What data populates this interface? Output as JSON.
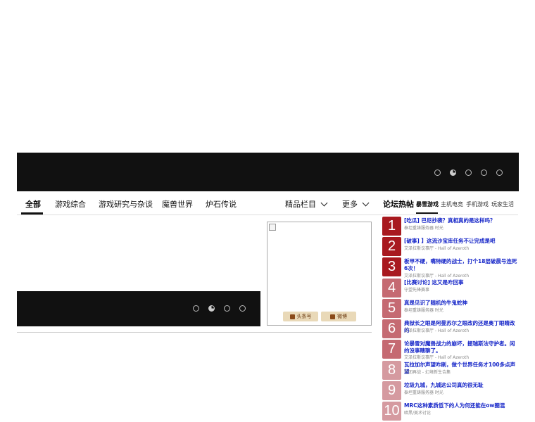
{
  "nav": {
    "tabs": [
      "全部",
      "游戏综合",
      "游戏研究与杂谈",
      "魔兽世界",
      "炉石传说"
    ],
    "featured": "精品栏目",
    "more": "更多"
  },
  "promo": {
    "tag1": "头条号",
    "tag2": "微博"
  },
  "forum": {
    "title": "论坛热帖",
    "tabs": [
      "暴雪游戏",
      "主机电竞",
      "手机游戏",
      "玩家生活"
    ],
    "posts": [
      {
        "rank": "1",
        "title": "[吃瓜] 巴尼抄袭？真相真的是这样吗？",
        "source": "泰坦重铸服务器 时光"
      },
      {
        "rank": "2",
        "title": "[破事] 】这流沙宝库任务不让完成是吧",
        "source": "艾泽拉斯议事厅 - Hall of Azeroth"
      },
      {
        "rank": "3",
        "title": "板甲不硬，嘴特硬的战士，打个18层破晨号连死6次！",
        "source": "艾泽拉斯议事厅 - Hall of Azeroth"
      },
      {
        "rank": "4",
        "title": "[比赛讨论] 这又是咋回事",
        "source": "守望先锋赛事"
      },
      {
        "rank": "5",
        "title": "真是见识了随机的牛鬼蛇神",
        "source": "泰坦重铸服务器 时光"
      },
      {
        "rank": "6",
        "title": "典狱长之眼是阿曼苏尔之眼改的还是奥丁眼睛改的",
        "source": "艾泽拉斯议事厅 - Hall of Azeroth"
      },
      {
        "rank": "7",
        "title": "论暴雪对魔兽战力的崩坏，提瑞斯法守护者。闲的没事瞎聊了。",
        "source": "艾泽拉斯议事厅 - Hall of Azeroth"
      },
      {
        "rank": "8",
        "title": "瓦拉加尔声望咋刷，做个世界任务才100多点声望",
        "source": "军团再战 - 幻境新生合集"
      },
      {
        "rank": "9",
        "title": "垃圾九城，九城这公司真的很无耻",
        "source": "泰坦重铸服务器 时光"
      },
      {
        "rank": "10",
        "title": "MRC这种素质低下的人为何还能在ow圈混",
        "source": "暗黑/美术讨论"
      }
    ]
  }
}
